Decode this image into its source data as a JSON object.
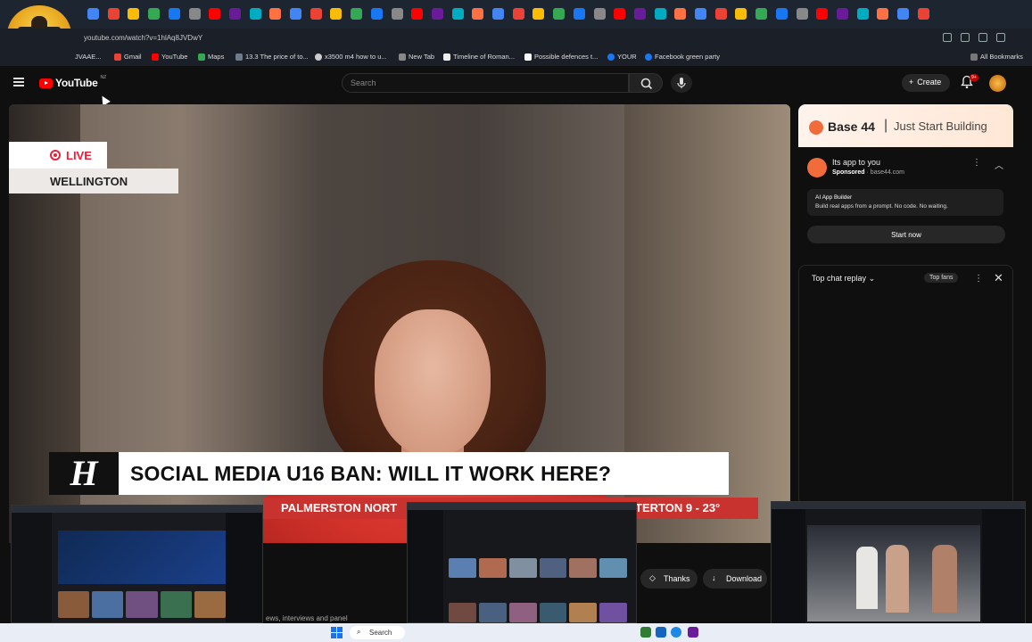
{
  "browser": {
    "address": "youtube.com/watch?v=1hlAq8JVDwY",
    "bookmarks": [
      "JVAAE...",
      "Gmail",
      "YouTube",
      "Maps",
      "13.3 The price of to...",
      "x3500 m4 how to u...",
      "New Tab",
      "Timeline of Roman...",
      "Possible defences t...",
      "YOUR",
      "Facebook green party"
    ],
    "all_bookmarks": "All Bookmarks"
  },
  "youtube": {
    "logo": "YouTube",
    "country": "NZ",
    "search_placeholder": "Search",
    "create_label": "Create",
    "notif_badge": "9+"
  },
  "video": {
    "live_label": "LIVE",
    "location": "WELLINGTON",
    "headline": "SOCIAL MEDIA U16 BAN: WILL IT WORK HERE?",
    "ticker_left": "PALMERSTON NORT",
    "ticker_right": "TERTON 9 - 23°",
    "brand_letter": "H"
  },
  "ad": {
    "brand": "Base 44",
    "slogan": "Just Start Building",
    "title": "Its app to you",
    "sponsored": "Sponsored",
    "domain": "base44.com",
    "desc_title": "AI App Builder",
    "desc_body": "Build real apps from a prompt. No code. No waiting.",
    "cta": "Start now"
  },
  "chat": {
    "header": "Top chat replay",
    "top_fans": "Top fans"
  },
  "actions": {
    "thanks": "Thanks",
    "download": "Download"
  },
  "desc_snippet": "ews, interviews and panel",
  "taskbar": {
    "search": "Search"
  },
  "colors": {
    "youtube_red": "#ff0000",
    "ticker_red": "#c8332f",
    "live_red": "#e8203a",
    "brand_orange": "#f26b3a"
  }
}
